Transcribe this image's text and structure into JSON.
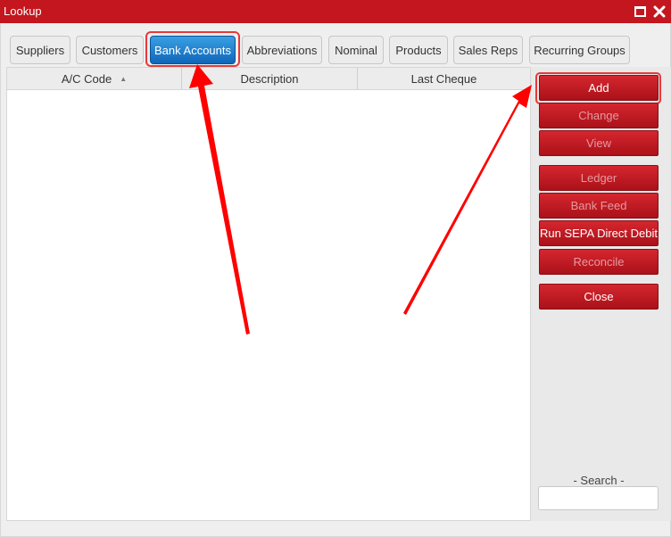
{
  "window": {
    "title": "Lookup"
  },
  "tabs": [
    {
      "label": "Suppliers",
      "active": false
    },
    {
      "label": "Customers",
      "active": false
    },
    {
      "label": "Bank Accounts",
      "active": true
    },
    {
      "label": "Abbreviations",
      "active": false
    },
    {
      "label": "Nominal",
      "active": false
    },
    {
      "label": "Products",
      "active": false
    },
    {
      "label": "Sales Reps",
      "active": false
    },
    {
      "label": "Recurring Groups",
      "active": false
    }
  ],
  "grid": {
    "columns": [
      {
        "label": "A/C Code",
        "sorted": "ascending"
      },
      {
        "label": "Description"
      },
      {
        "label": "Last Cheque"
      }
    ],
    "rows": []
  },
  "actions": [
    {
      "label": "Add",
      "enabled": true
    },
    {
      "label": "Change",
      "enabled": false
    },
    {
      "label": "View",
      "enabled": false
    },
    {
      "label": "Ledger",
      "enabled": false
    },
    {
      "label": "Bank Feed",
      "enabled": false
    },
    {
      "label": "Run SEPA Direct Debit",
      "enabled": true
    },
    {
      "label": "Reconcile",
      "enabled": false
    },
    {
      "label": "Close",
      "enabled": true
    }
  ],
  "search": {
    "label": "- Search -",
    "value": ""
  },
  "colors": {
    "titlebar": "#c4161f",
    "active_tab": "#1b78c9",
    "button": "#c01b24",
    "annotation": "#e53a3a"
  },
  "icons": {
    "maximize": "maximize-icon",
    "close": "close-icon",
    "sort": "sort-ascending-icon"
  }
}
